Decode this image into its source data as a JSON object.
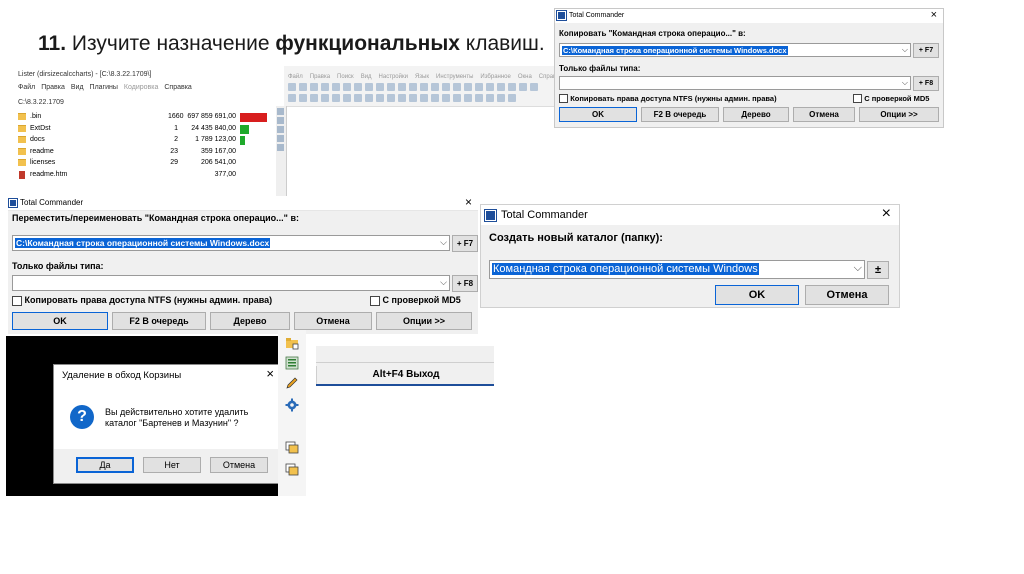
{
  "heading": {
    "number": "11.",
    "text_before": "Изучите назначение",
    "text_bold": "функциональных",
    "text_after": "клавиш."
  },
  "lister": {
    "title": "Lister (dirsizecalccharts) - [C:\\8.3.22.1709\\]",
    "menu": [
      "Файл",
      "Правка",
      "Вид",
      "Плагины",
      "Кодировка",
      "Справка"
    ],
    "path": "C:\\8.3.22.1709",
    "rows": [
      {
        "name": ".bin",
        "count": "1660",
        "size": "697 859 691,00",
        "bar_fraction": 1.0,
        "bar_color": "#d81e1e"
      },
      {
        "name": "ExtDst",
        "count": "1",
        "size": "24 435 840,00",
        "bar_fraction": 0.35,
        "bar_color": "#1faa2b"
      },
      {
        "name": "docs",
        "count": "2",
        "size": "1 789 123,00",
        "bar_fraction": 0.2,
        "bar_color": "#1faa2b"
      },
      {
        "name": "readme",
        "count": "23",
        "size": "359 167,00",
        "bar_fraction": 0,
        "bar_color": "#1faa2b"
      },
      {
        "name": "licenses",
        "count": "29",
        "size": "206 541,00",
        "bar_fraction": 0,
        "bar_color": "#1faa2b"
      },
      {
        "name": "readme.htm",
        "count": "",
        "size": "377,00",
        "bar_fraction": 0,
        "bar_color": "#1faa2b"
      }
    ]
  },
  "app_toolbar": {
    "menu": [
      "Файл",
      "Правка",
      "Поиск",
      "Вид",
      "Настройки",
      "Язык",
      "Инструменты",
      "Избранное",
      "Окна",
      "Справка"
    ]
  },
  "tc_copy": {
    "title": "Total Commander",
    "copy_label": "Копировать \"Командная строка операцио...\" в:",
    "target_value": "C:\\Командная строка операционной системы Windows.docx",
    "f7_label": "+ F7",
    "filter_label": "Только файлы типа:",
    "filter_value": "",
    "f8_label": "+ F8",
    "ntfs_label": "Копировать права доступа NTFS (нужны админ. права)",
    "md5_label": "С проверкой MD5",
    "buttons": [
      "OK",
      "F2 В очередь",
      "Дерево",
      "Отмена",
      "Опции >>"
    ]
  },
  "tc_move": {
    "title": "Total Commander",
    "move_label": "Переместить/переименовать \"Командная строка операцио...\" в:",
    "target_value": "C:\\Командная строка операционной системы Windows.docx",
    "f7_label": "+ F7",
    "filter_label": "Только файлы типа:",
    "filter_value": "",
    "f8_label": "+ F8",
    "ntfs_label": "Копировать права доступа NTFS (нужны админ. права)",
    "md5_label": "С проверкой MD5",
    "buttons": [
      "OK",
      "F2 В очередь",
      "Дерево",
      "Отмена",
      "Опции >>"
    ]
  },
  "tc_mkdir": {
    "title": "Total Commander",
    "label": "Создать новый каталог (папку):",
    "value": "Командная строка операционной системы Windows",
    "plusminus": "±",
    "ok": "OK",
    "cancel": "Отмена"
  },
  "delete_dialog": {
    "title": "Удаление в обход Корзины",
    "question_mark": "?",
    "message_line1": "Вы действительно хотите удалить",
    "message_line2": "каталог \"Бартенев и Мазунин\" ?",
    "yes": "Да",
    "no": "Нет",
    "cancel": "Отмена"
  },
  "altf4": {
    "label": "Alt+F4 Выход"
  },
  "icons": {
    "folder_color": "#f2c14e",
    "tc_icon_color": "#1e4e9a",
    "selection_color": "#0a64d6"
  }
}
